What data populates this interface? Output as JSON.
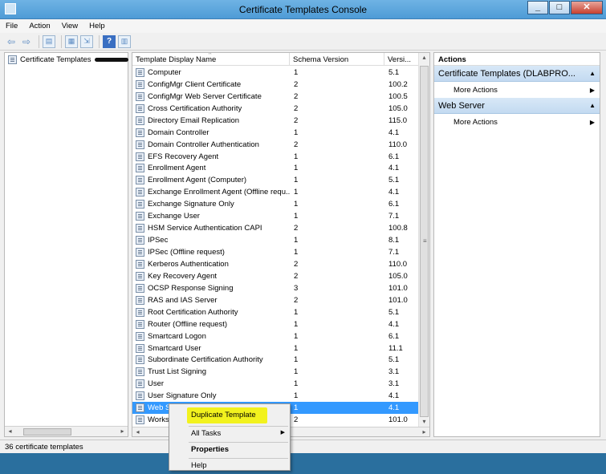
{
  "window": {
    "title": "Certificate Templates Console"
  },
  "menu": [
    "File",
    "Action",
    "View",
    "Help"
  ],
  "tree": {
    "root_label": "Certificate Templates"
  },
  "list": {
    "columns": [
      "Template Display Name",
      "Schema Version",
      "Versi..."
    ],
    "rows": [
      {
        "name": "Computer",
        "schema": "1",
        "version": "5.1"
      },
      {
        "name": "ConfigMgr Client Certificate",
        "schema": "2",
        "version": "100.2"
      },
      {
        "name": "ConfigMgr Web Server Certificate",
        "schema": "2",
        "version": "100.5"
      },
      {
        "name": "Cross Certification Authority",
        "schema": "2",
        "version": "105.0"
      },
      {
        "name": "Directory Email Replication",
        "schema": "2",
        "version": "115.0"
      },
      {
        "name": "Domain Controller",
        "schema": "1",
        "version": "4.1"
      },
      {
        "name": "Domain Controller Authentication",
        "schema": "2",
        "version": "110.0"
      },
      {
        "name": "EFS Recovery Agent",
        "schema": "1",
        "version": "6.1"
      },
      {
        "name": "Enrollment Agent",
        "schema": "1",
        "version": "4.1"
      },
      {
        "name": "Enrollment Agent (Computer)",
        "schema": "1",
        "version": "5.1"
      },
      {
        "name": "Exchange Enrollment Agent (Offline requ...",
        "schema": "1",
        "version": "4.1"
      },
      {
        "name": "Exchange Signature Only",
        "schema": "1",
        "version": "6.1"
      },
      {
        "name": "Exchange User",
        "schema": "1",
        "version": "7.1"
      },
      {
        "name": "HSM Service Authentication CAPI",
        "schema": "2",
        "version": "100.8"
      },
      {
        "name": "IPSec",
        "schema": "1",
        "version": "8.1"
      },
      {
        "name": "IPSec (Offline request)",
        "schema": "1",
        "version": "7.1"
      },
      {
        "name": "Kerberos Authentication",
        "schema": "2",
        "version": "110.0"
      },
      {
        "name": "Key Recovery Agent",
        "schema": "2",
        "version": "105.0"
      },
      {
        "name": "OCSP Response Signing",
        "schema": "3",
        "version": "101.0"
      },
      {
        "name": "RAS and IAS Server",
        "schema": "2",
        "version": "101.0"
      },
      {
        "name": "Root Certification Authority",
        "schema": "1",
        "version": "5.1"
      },
      {
        "name": "Router (Offline request)",
        "schema": "1",
        "version": "4.1"
      },
      {
        "name": "Smartcard Logon",
        "schema": "1",
        "version": "6.1"
      },
      {
        "name": "Smartcard User",
        "schema": "1",
        "version": "11.1"
      },
      {
        "name": "Subordinate Certification Authority",
        "schema": "1",
        "version": "5.1"
      },
      {
        "name": "Trust List Signing",
        "schema": "1",
        "version": "3.1"
      },
      {
        "name": "User",
        "schema": "1",
        "version": "3.1"
      },
      {
        "name": "User Signature Only",
        "schema": "1",
        "version": "4.1"
      },
      {
        "name": "Web Se",
        "schema": "1",
        "version": "4.1"
      },
      {
        "name": "Workst",
        "schema": "2",
        "version": "101.0"
      }
    ]
  },
  "actions": {
    "header": "Actions",
    "sections": [
      {
        "title": "Certificate Templates (DLABPRO...",
        "items": [
          "More Actions"
        ]
      },
      {
        "title": "Web Server",
        "items": [
          "More Actions"
        ]
      }
    ]
  },
  "status": {
    "text": "36 certificate templates"
  },
  "context_menu": {
    "items": [
      "Duplicate Template",
      "All Tasks",
      "Properties",
      "Help"
    ]
  },
  "colors": {
    "selection": "#3399ff",
    "highlight": "#f2f21e",
    "titlebar": "#4e9bd6"
  }
}
